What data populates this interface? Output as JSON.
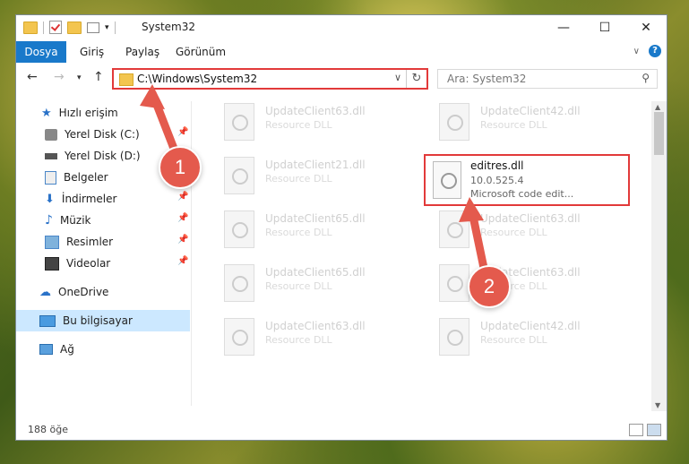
{
  "window": {
    "title": "System32",
    "controls": {
      "minimize": "—",
      "maximize": "☐",
      "close": "✕"
    }
  },
  "ribbon": {
    "tabs": [
      "Dosya",
      "Giriş",
      "Paylaş",
      "Görünüm"
    ]
  },
  "address_bar": {
    "path": "C:\\Windows\\System32",
    "search_placeholder": "Ara: System32"
  },
  "sidebar": {
    "items": [
      {
        "label": "Hızlı erişim",
        "icon": "star-icon"
      },
      {
        "label": "Yerel Disk (C:)",
        "icon": "drive-icon"
      },
      {
        "label": "Yerel Disk (D:)",
        "icon": "drive-icon"
      },
      {
        "label": "Belgeler",
        "icon": "documents-icon"
      },
      {
        "label": "İndirmeler",
        "icon": "download-icon"
      },
      {
        "label": "Müzik",
        "icon": "music-icon"
      },
      {
        "label": "Resimler",
        "icon": "pictures-icon"
      },
      {
        "label": "Videolar",
        "icon": "video-icon"
      },
      {
        "label": "OneDrive",
        "icon": "cloud-icon"
      },
      {
        "label": "Bu bilgisayar",
        "icon": "computer-icon"
      },
      {
        "label": "Ağ",
        "icon": "network-icon"
      }
    ]
  },
  "files": [
    {
      "name": "UpdateClient63.dll",
      "type": "Resource DLL"
    },
    {
      "name": "UpdateClient42.dll",
      "type": "Resource DLL"
    },
    {
      "name": "UpdateClient21.dll",
      "type": "Resource DLL"
    },
    {
      "name": "UpdateClient65.dll",
      "type": "Resource DLL"
    },
    {
      "name": "UpdateClient63.dll",
      "type": "Resource DLL"
    },
    {
      "name": "UpdateClient65.dll",
      "type": "Resource DLL"
    },
    {
      "name": "UpdateClient63.dll",
      "type": "Resource DLL"
    },
    {
      "name": "UpdateClient63.dll",
      "type": "Resource DLL"
    },
    {
      "name": "UpdateClient42.dll",
      "type": "Resource DLL"
    }
  ],
  "selected_file": {
    "name": "editres.dll",
    "version": "10.0.525.4",
    "description": "Microsoft code edit..."
  },
  "status": {
    "count": "188 öğe"
  },
  "annotations": {
    "step1": "1",
    "step2": "2"
  },
  "colors": {
    "highlight": "#e23a3a",
    "badge": "#e45a4d",
    "accent": "#1979ca"
  }
}
